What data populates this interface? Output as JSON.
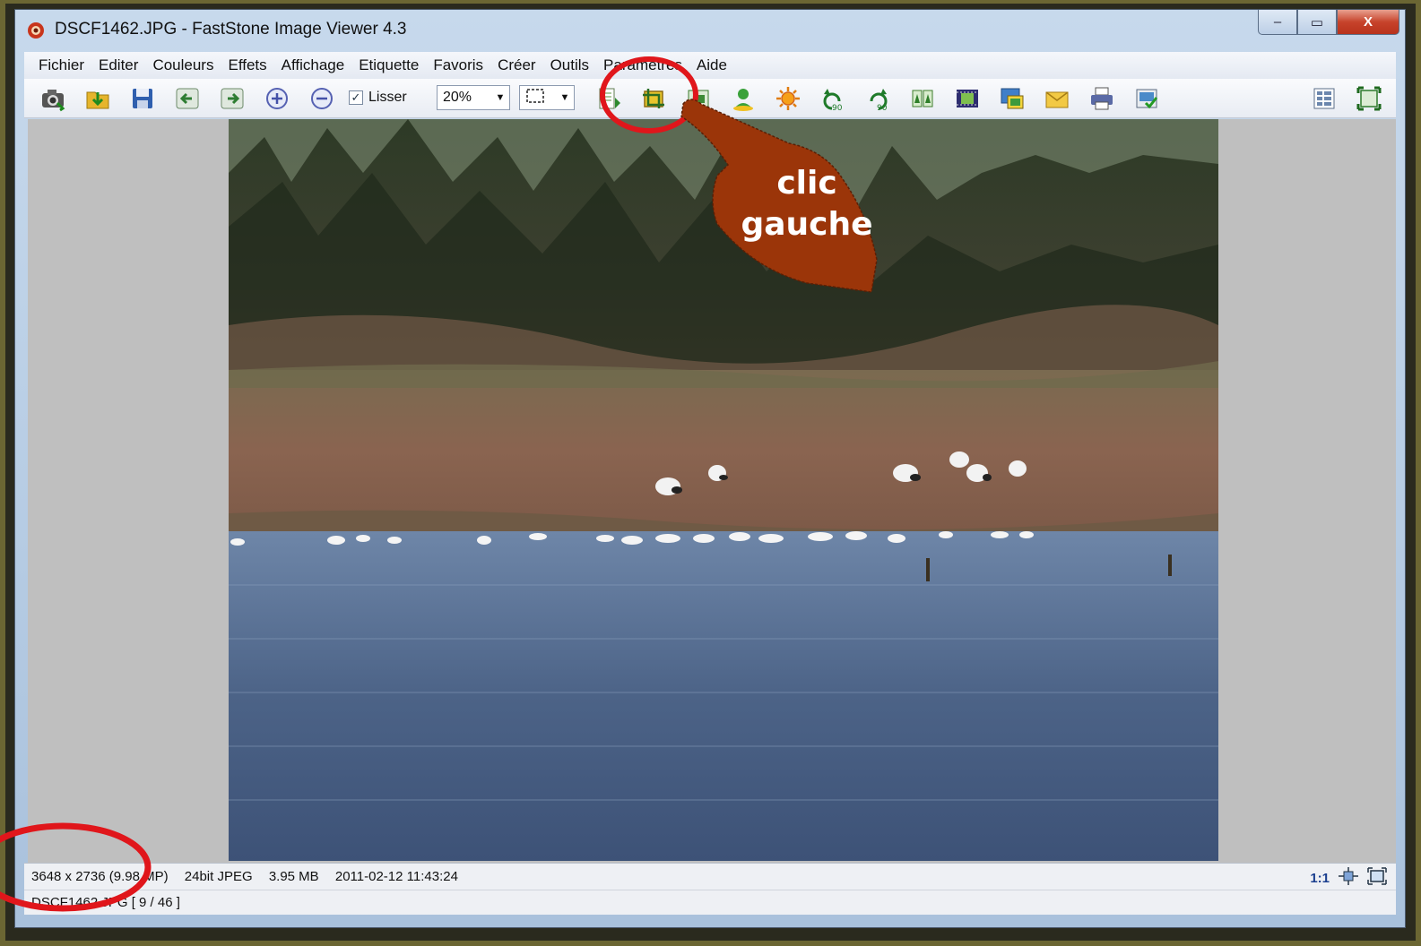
{
  "window": {
    "title": "DSCF1462.JPG  -  FastStone Image Viewer 4.3",
    "minimize_label": "–",
    "maximize_label": "▭",
    "close_label": "X"
  },
  "menu": [
    "Fichier",
    "Editer",
    "Couleurs",
    "Effets",
    "Affichage",
    "Etiquette",
    "Favoris",
    "Créer",
    "Outils",
    "Paramètres",
    "Aide"
  ],
  "toolbar": {
    "smooth_label": "Lisser",
    "smooth_checked": true,
    "zoom_value": "20%",
    "icons": [
      "camera-icon",
      "open-folder-icon",
      "save-icon",
      "previous-icon",
      "next-icon",
      "zoom-in-icon",
      "zoom-out-icon",
      "crop-board-icon",
      "crop-icon",
      "resize-icon",
      "color-icon",
      "brightness-icon",
      "rotate-left-icon",
      "rotate-right-icon",
      "compare-icon",
      "slideshow-icon",
      "wallpaper-icon",
      "email-icon",
      "print-icon",
      "batch-icon",
      "browser-mode-icon",
      "fullscreen-icon"
    ]
  },
  "statusbar": {
    "dimensions": "3648 x 2736 (9.98 MP)",
    "format": "24bit JPEG",
    "size": "3.95 MB",
    "datetime": "2011-02-12 11:43:24",
    "zoom_label": "1:1",
    "filename": "DSCF1462.JPG [ 9 / 46 ]"
  },
  "annotation": {
    "line1": "clic",
    "line2": "gauche"
  },
  "colors": {
    "frame": "#6b6633",
    "annotation_circle": "#e0161b",
    "hand": "#9b3509"
  }
}
